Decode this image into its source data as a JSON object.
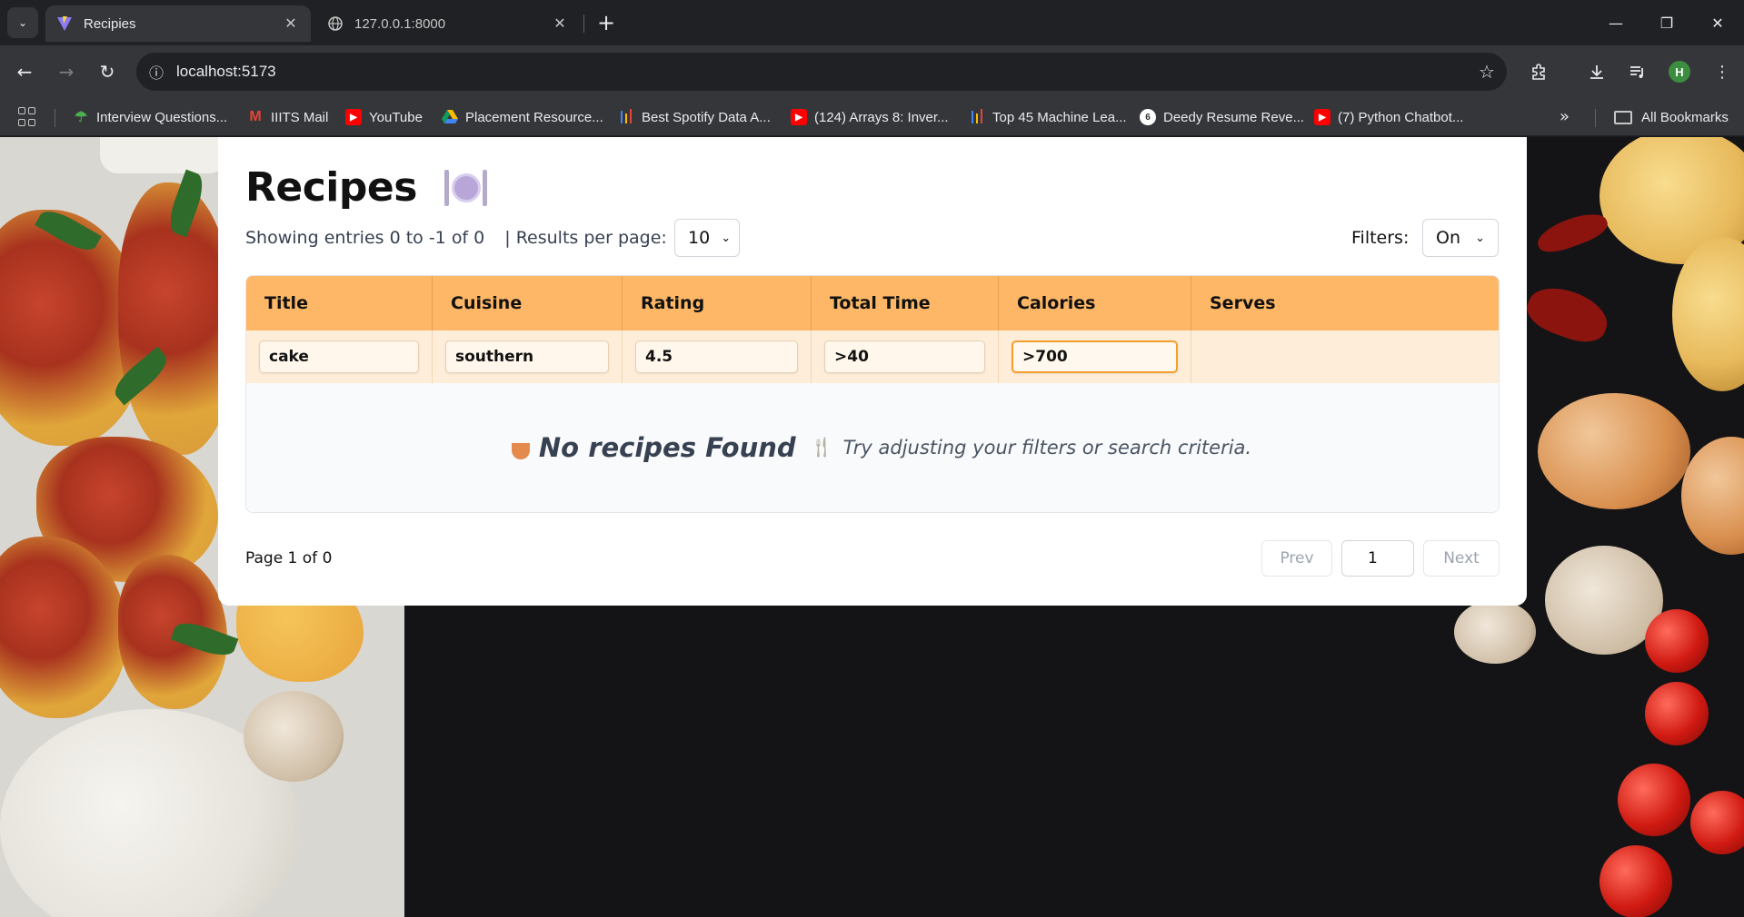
{
  "browser": {
    "tabs": [
      {
        "title": "Recipies",
        "favicon": "vite-icon",
        "active": true
      },
      {
        "title": "127.0.0.1:8000",
        "favicon": "globe-icon",
        "active": false
      }
    ],
    "url": "localhost:5173",
    "profile_initial": "H",
    "bookmarks": [
      {
        "label": "Interview Questions...",
        "icon": "interview-icon",
        "color": "#4caf50"
      },
      {
        "label": "IIITS Mail",
        "icon": "gmail-icon",
        "color": "#ea4335"
      },
      {
        "label": "YouTube",
        "icon": "youtube-icon",
        "color": "#ff0000"
      },
      {
        "label": "Placement Resource...",
        "icon": "drive-icon",
        "color": "#fbbc04"
      },
      {
        "label": "Best Spotify Data A...",
        "icon": "chart-icon",
        "color": "#4285f4"
      },
      {
        "label": "(124) Arrays 8: Inver...",
        "icon": "youtube-icon",
        "color": "#ff0000"
      },
      {
        "label": "Top 45 Machine Lea...",
        "icon": "chart-icon",
        "color": "#4285f4"
      },
      {
        "label": "Deedy Resume Reve...",
        "icon": "overleaf-icon",
        "color": "#ffffff"
      },
      {
        "label": "(7) Python Chatbot...",
        "icon": "youtube-icon",
        "color": "#ff0000"
      }
    ],
    "all_bookmarks": "All Bookmarks"
  },
  "page": {
    "title": "Recipes",
    "entries_text": "Showing entries 0 to -1 of 0",
    "per_page_label": "| Results per page:",
    "per_page_value": "10",
    "filters_label": "Filters:",
    "filters_value": "On",
    "table": {
      "columns": [
        "Title",
        "Cuisine",
        "Rating",
        "Total Time",
        "Calories",
        "Serves"
      ],
      "filters": [
        "cake",
        "southern",
        "4.5",
        ">40",
        ">700",
        ""
      ]
    },
    "empty_title": "No recipes Found",
    "empty_message": "Try adjusting your filters or search criteria.",
    "page_info": "Page 1 of 0",
    "prev_label": "Prev",
    "next_label": "Next",
    "current_page": "1"
  }
}
